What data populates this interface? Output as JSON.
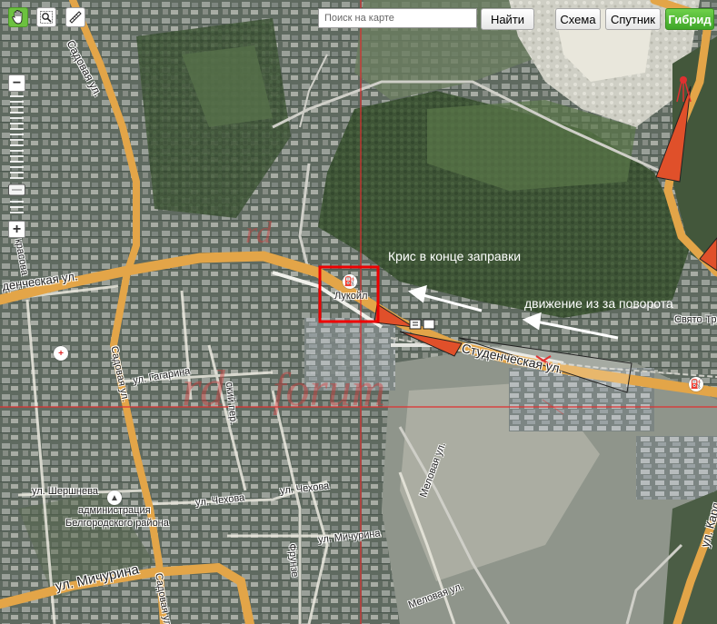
{
  "toolbar": {
    "tools": [
      {
        "name": "hand-tool",
        "icon": "hand-icon",
        "active": true
      },
      {
        "name": "magnifier-tool",
        "icon": "magnifier-icon",
        "active": false
      },
      {
        "name": "ruler-tool",
        "icon": "ruler-icon",
        "active": false
      }
    ],
    "search_placeholder": "Поиск на карте",
    "search_button": "Найти",
    "layers": [
      "Схема",
      "Спутник",
      "Гибрид"
    ],
    "active_layer": "Гибрид"
  },
  "zoom": {
    "plus": "+",
    "minus": "−"
  },
  "colors": {
    "road": "#e3a548",
    "crosshair": "#e03030",
    "marker_box": "#ee0000",
    "arrow": "#ffffff",
    "triangle": "#e0502a",
    "active_layer": "#5ab934"
  },
  "labels": {
    "sadovaya_top": "Садовая ул.",
    "studencheskaya_left": "денческая ул.",
    "studencheskaya_right": "Студенческая ул.",
    "lukoil": "Лукойл",
    "gagarina": "ул. Гагарина",
    "sadovaya_mid": "Садовая ул.",
    "sadovaya_bottom": "Садовая ул.",
    "shershneva": "ул. Шершнева",
    "chekhova": "ул. Чехова",
    "chekhova2": "ул. Чехова",
    "michurina_small": "ул. Мичурина",
    "michurina_big": "ул. Мичурина",
    "admin1": "администрация",
    "admin2": "Белгородского района",
    "krasova": "красова",
    "svyato": "Свято-Тр",
    "melovaya": "Меловая ул.",
    "melovaya2": "Меловая ул.",
    "frunze": "Фрунзе",
    "karl": "ул. Карл",
    "sovetsky": "ский пер."
  },
  "notes": {
    "kris": "Крис в конце заправки",
    "movement": "движение из за поворота"
  },
  "watermark": {
    "text1": "rd",
    "text2": "rd",
    "text3": "forum"
  }
}
